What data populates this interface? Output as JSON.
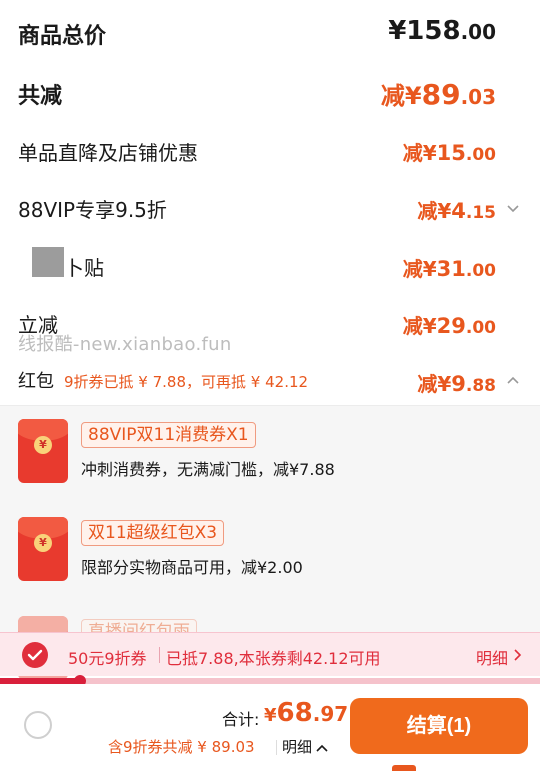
{
  "summary": {
    "total": {
      "label": "商品总价",
      "currency": "¥",
      "integer": "158",
      "decimal": ".00"
    },
    "reduce": {
      "label": "共减",
      "prefix": "减¥",
      "integer": "89",
      "decimal": ".03"
    }
  },
  "discounts": [
    {
      "label": "单品直降及店铺优惠",
      "prefix": "减¥",
      "integer": "15",
      "decimal": ".00"
    },
    {
      "label": "88VIP专享9.5折",
      "prefix": "减¥",
      "integer": "4",
      "decimal": ".15"
    },
    {
      "label": "补贴",
      "visible_fragment": "卜贴",
      "prefix": "减¥",
      "integer": "31",
      "decimal": ".00"
    },
    {
      "label": "立减",
      "prefix": "减¥",
      "integer": "29",
      "decimal": ".00"
    }
  ],
  "watermark": "线报酷-new.xianbao.fun",
  "hongbao": {
    "label": "红包",
    "sub": "9折券已抵 ¥ 7.88，可再抵 ¥ 42.12",
    "prefix": "减¥",
    "integer": "9",
    "decimal": ".88"
  },
  "coupons": [
    {
      "tag": "88VIP双11消费券X1",
      "desc": "冲刺消费券，无满减门槛，减¥7.88"
    },
    {
      "tag": "双11超级红包X3",
      "desc": "限部分实物商品可用，减¥2.00"
    },
    {
      "tag": "直播间红包雨",
      "desc": ""
    }
  ],
  "coupon_bar": {
    "coupon_name": "50元9折券",
    "status": "已抵7.88,本张券剩42.12可用",
    "detail": "明细",
    "progress_fraction": 0.149
  },
  "footer": {
    "sum_label": "合计:",
    "currency": "¥",
    "integer": "68",
    "decimal": ".97",
    "sub": "含9折券共减 ¥ 89.03",
    "detail": "明细",
    "checkout": "结算(1)"
  },
  "colors": {
    "accent": "#e8571e",
    "red": "#e02e3c",
    "checkout": "#f06a1c",
    "bar_bg": "#fde8ec"
  }
}
